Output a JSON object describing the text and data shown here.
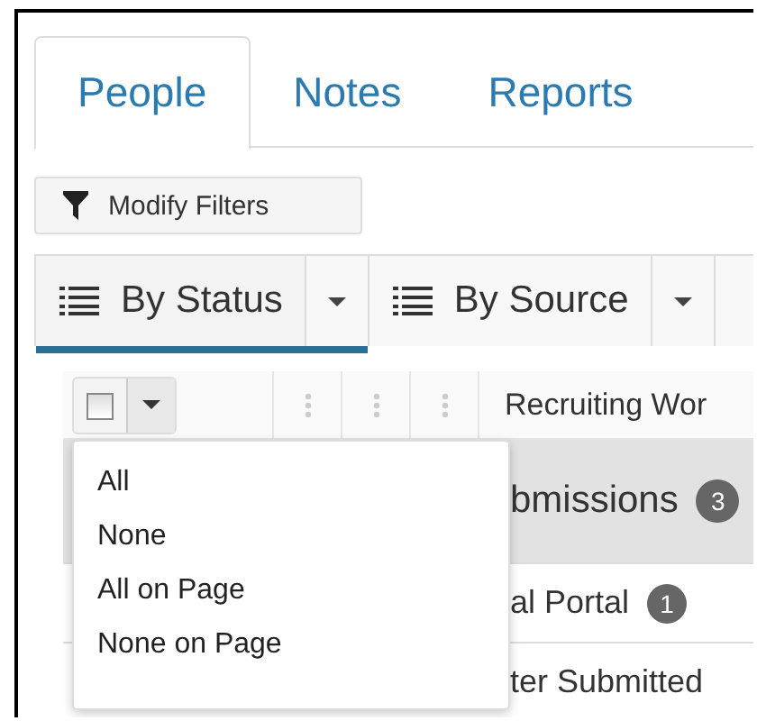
{
  "tabs": [
    {
      "label": "People",
      "selected": true
    },
    {
      "label": "Notes",
      "selected": false
    },
    {
      "label": "Reports",
      "selected": false
    }
  ],
  "filter_button": {
    "label": "Modify Filters"
  },
  "view_tabs": [
    {
      "label": "By Status",
      "selected": true
    },
    {
      "label": "By Source",
      "selected": false
    }
  ],
  "grid": {
    "select_all": {
      "checked": false
    },
    "header_column": "Recruiting Wor",
    "rows": [
      {
        "kind": "group",
        "text": "bmissions",
        "count": "3"
      },
      {
        "kind": "item",
        "text": "al Portal",
        "count": "1"
      },
      {
        "kind": "item",
        "text": "ter Submitted"
      }
    ]
  },
  "select_menu": {
    "items": [
      "All",
      "None",
      "All on Page",
      "None on Page"
    ]
  }
}
